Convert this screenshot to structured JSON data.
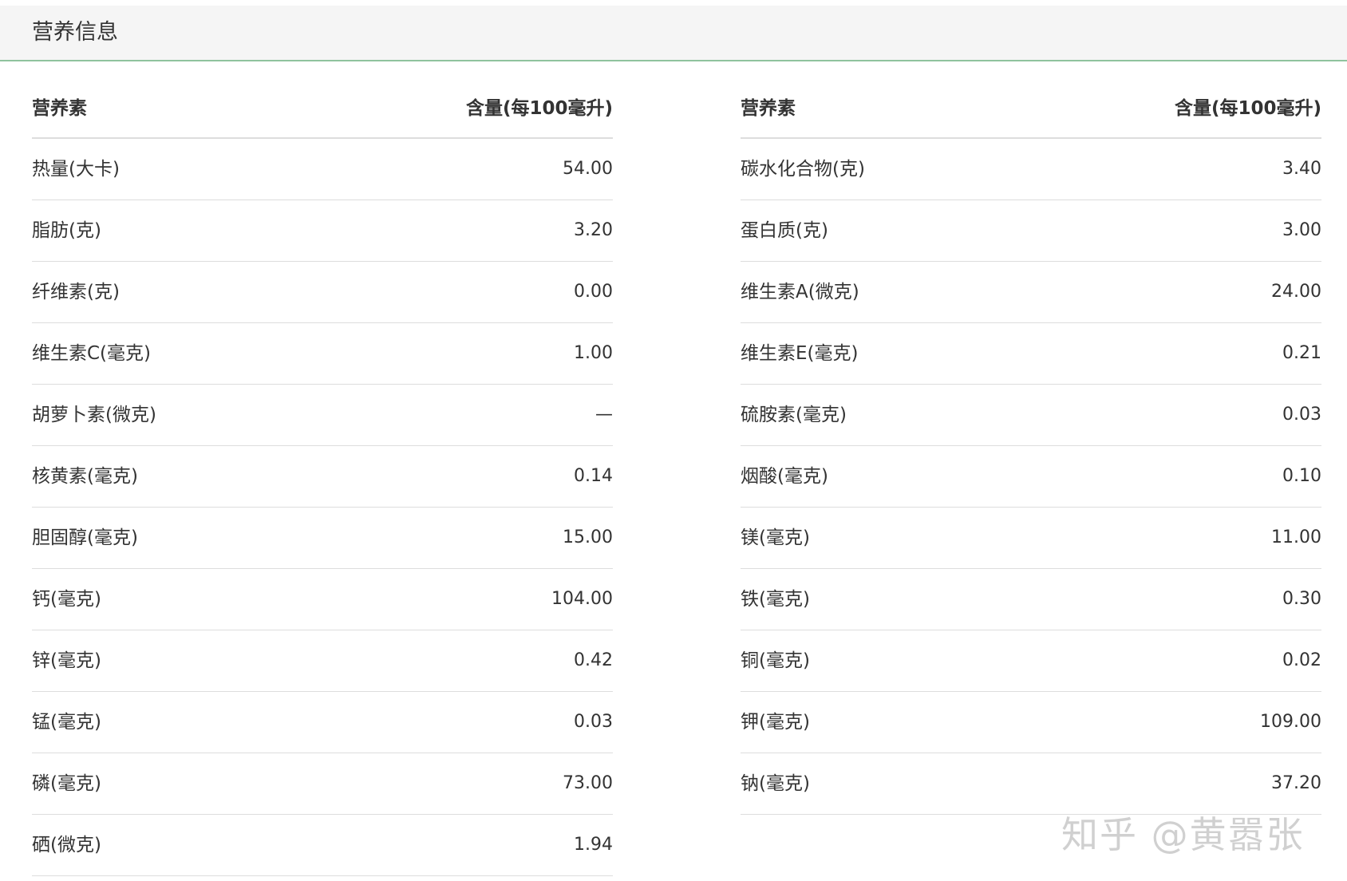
{
  "panel": {
    "title": "营养信息"
  },
  "headers": {
    "nutrient": "营养素",
    "amount": "含量(每100毫升)"
  },
  "left_rows": [
    {
      "name": "热量(大卡)",
      "value": "54.00"
    },
    {
      "name": "脂肪(克)",
      "value": "3.20"
    },
    {
      "name": "纤维素(克)",
      "value": "0.00"
    },
    {
      "name": "维生素C(毫克)",
      "value": "1.00"
    },
    {
      "name": "胡萝卜素(微克)",
      "value": "—"
    },
    {
      "name": "核黄素(毫克)",
      "value": "0.14"
    },
    {
      "name": "胆固醇(毫克)",
      "value": "15.00"
    },
    {
      "name": "钙(毫克)",
      "value": "104.00"
    },
    {
      "name": "锌(毫克)",
      "value": "0.42"
    },
    {
      "name": "锰(毫克)",
      "value": "0.03"
    },
    {
      "name": "磷(毫克)",
      "value": "73.00"
    },
    {
      "name": "硒(微克)",
      "value": "1.94"
    }
  ],
  "right_rows": [
    {
      "name": "碳水化合物(克)",
      "value": "3.40"
    },
    {
      "name": "蛋白质(克)",
      "value": "3.00"
    },
    {
      "name": "维生素A(微克)",
      "value": "24.00"
    },
    {
      "name": "维生素E(毫克)",
      "value": "0.21"
    },
    {
      "name": "硫胺素(毫克)",
      "value": "0.03"
    },
    {
      "name": "烟酸(毫克)",
      "value": "0.10"
    },
    {
      "name": "镁(毫克)",
      "value": "11.00"
    },
    {
      "name": "铁(毫克)",
      "value": "0.30"
    },
    {
      "name": "铜(毫克)",
      "value": "0.02"
    },
    {
      "name": "钾(毫克)",
      "value": "109.00"
    },
    {
      "name": "钠(毫克)",
      "value": "37.20"
    }
  ],
  "watermark": "知乎 @黄嚣张"
}
